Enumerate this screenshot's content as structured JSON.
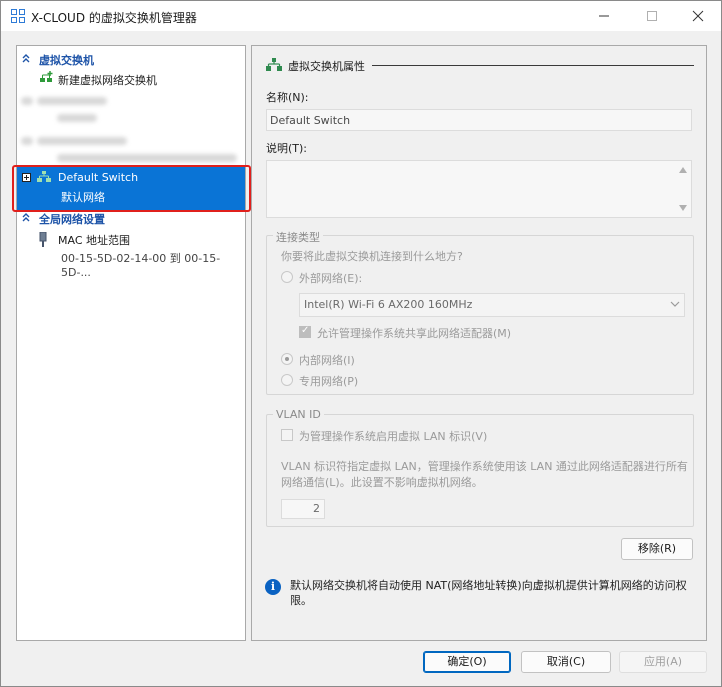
{
  "window": {
    "title": "X-CLOUD 的虚拟交换机管理器"
  },
  "tree": {
    "section_switches": "虚拟交换机",
    "new_switch": "新建虚拟网络交换机",
    "selected_switch": {
      "name": "Default Switch",
      "subtitle": "默认网络"
    },
    "section_global": "全局网络设置",
    "mac_range": {
      "label": "MAC 地址范围",
      "value": "00-15-5D-02-14-00 到 00-15-5D-..."
    }
  },
  "panel": {
    "header": "虚拟交换机属性",
    "name_label": "名称(N):",
    "name_value": "Default Switch",
    "notes_label": "说明(T):",
    "notes_value": "",
    "conn_type": {
      "legend": "连接类型",
      "question": "你要将此虚拟交换机连接到什么地方?",
      "external_label": "外部网络(E):",
      "adapter_value": "Intel(R) Wi-Fi 6 AX200 160MHz",
      "allow_share_label": "允许管理操作系统共享此网络适配器(M)",
      "internal_label": "内部网络(I)",
      "private_label": "专用网络(P)"
    },
    "vlan": {
      "legend": "VLAN ID",
      "enable_label": "为管理操作系统启用虚拟 LAN 标识(V)",
      "description": "VLAN 标识符指定虚拟 LAN，管理操作系统使用该 LAN 通过此网络适配器进行所有网络通信(L)。此设置不影响虚拟机网络。",
      "id_value": "2"
    },
    "remove_button": "移除(R)",
    "info_text": "默认网络交换机将自动使用 NAT(网络地址转换)向虚拟机提供计算机网络的访问权限。"
  },
  "footer": {
    "ok": "确定(O)",
    "cancel": "取消(C)",
    "apply": "应用(A)"
  },
  "colors": {
    "selection": "#0a74d6",
    "section_text": "#1e54a8",
    "highlight_border": "#e0201c"
  }
}
